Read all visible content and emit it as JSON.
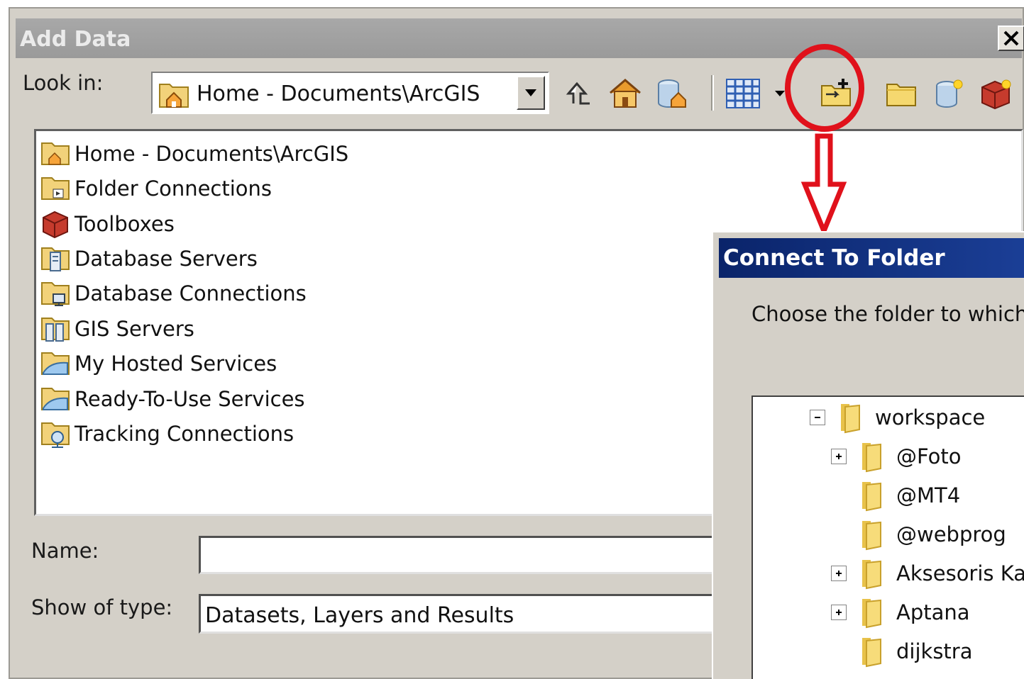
{
  "add_data": {
    "title": "Add Data",
    "close_glyph": "✕",
    "look_in_label": "Look in:",
    "look_in_value": "Home - Documents\\ArcGIS",
    "toolbar": [
      {
        "icon": "up-one-level-icon"
      },
      {
        "icon": "home-icon"
      },
      {
        "icon": "default-geodatabase-icon"
      },
      {
        "icon": "view-menu-icon"
      },
      {
        "icon": "connect-to-folder-icon"
      },
      {
        "icon": "new-folder-icon"
      },
      {
        "icon": "new-geodatabase-icon"
      },
      {
        "icon": "new-toolbox-icon"
      }
    ],
    "items": [
      {
        "label": "Home - Documents\\ArcGIS",
        "icon": "home-folder-icon"
      },
      {
        "label": "Folder Connections",
        "icon": "folder-connections-icon"
      },
      {
        "label": "Toolboxes",
        "icon": "toolbox-icon"
      },
      {
        "label": "Database Servers",
        "icon": "database-servers-icon"
      },
      {
        "label": "Database Connections",
        "icon": "database-connections-icon"
      },
      {
        "label": "GIS Servers",
        "icon": "gis-servers-icon"
      },
      {
        "label": "My Hosted Services",
        "icon": "hosted-services-icon"
      },
      {
        "label": "Ready-To-Use Services",
        "icon": "ready-to-use-services-icon"
      },
      {
        "label": "Tracking Connections",
        "icon": "tracking-connections-icon"
      }
    ],
    "name_label": "Name:",
    "name_value": "",
    "show_type_label": "Show of type:",
    "show_type_value": "Datasets, Layers and Results"
  },
  "annotation": {
    "highlight_color": "#e0111b"
  },
  "connect_to_folder": {
    "title": "Connect To Folder",
    "description": "Choose the folder to which",
    "tree": [
      {
        "label": "workspace",
        "toggle": "⊟",
        "level": 0
      },
      {
        "label": "@Foto",
        "toggle": "⊞",
        "level": 1
      },
      {
        "label": "@MT4",
        "toggle": "",
        "level": 1
      },
      {
        "label": "@webprog",
        "toggle": "",
        "level": 1
      },
      {
        "label": "Aksesoris Kay",
        "toggle": "⊞",
        "level": 1
      },
      {
        "label": "Aptana",
        "toggle": "⊞",
        "level": 1
      },
      {
        "label": "dijkstra",
        "toggle": "",
        "level": 1
      }
    ]
  }
}
